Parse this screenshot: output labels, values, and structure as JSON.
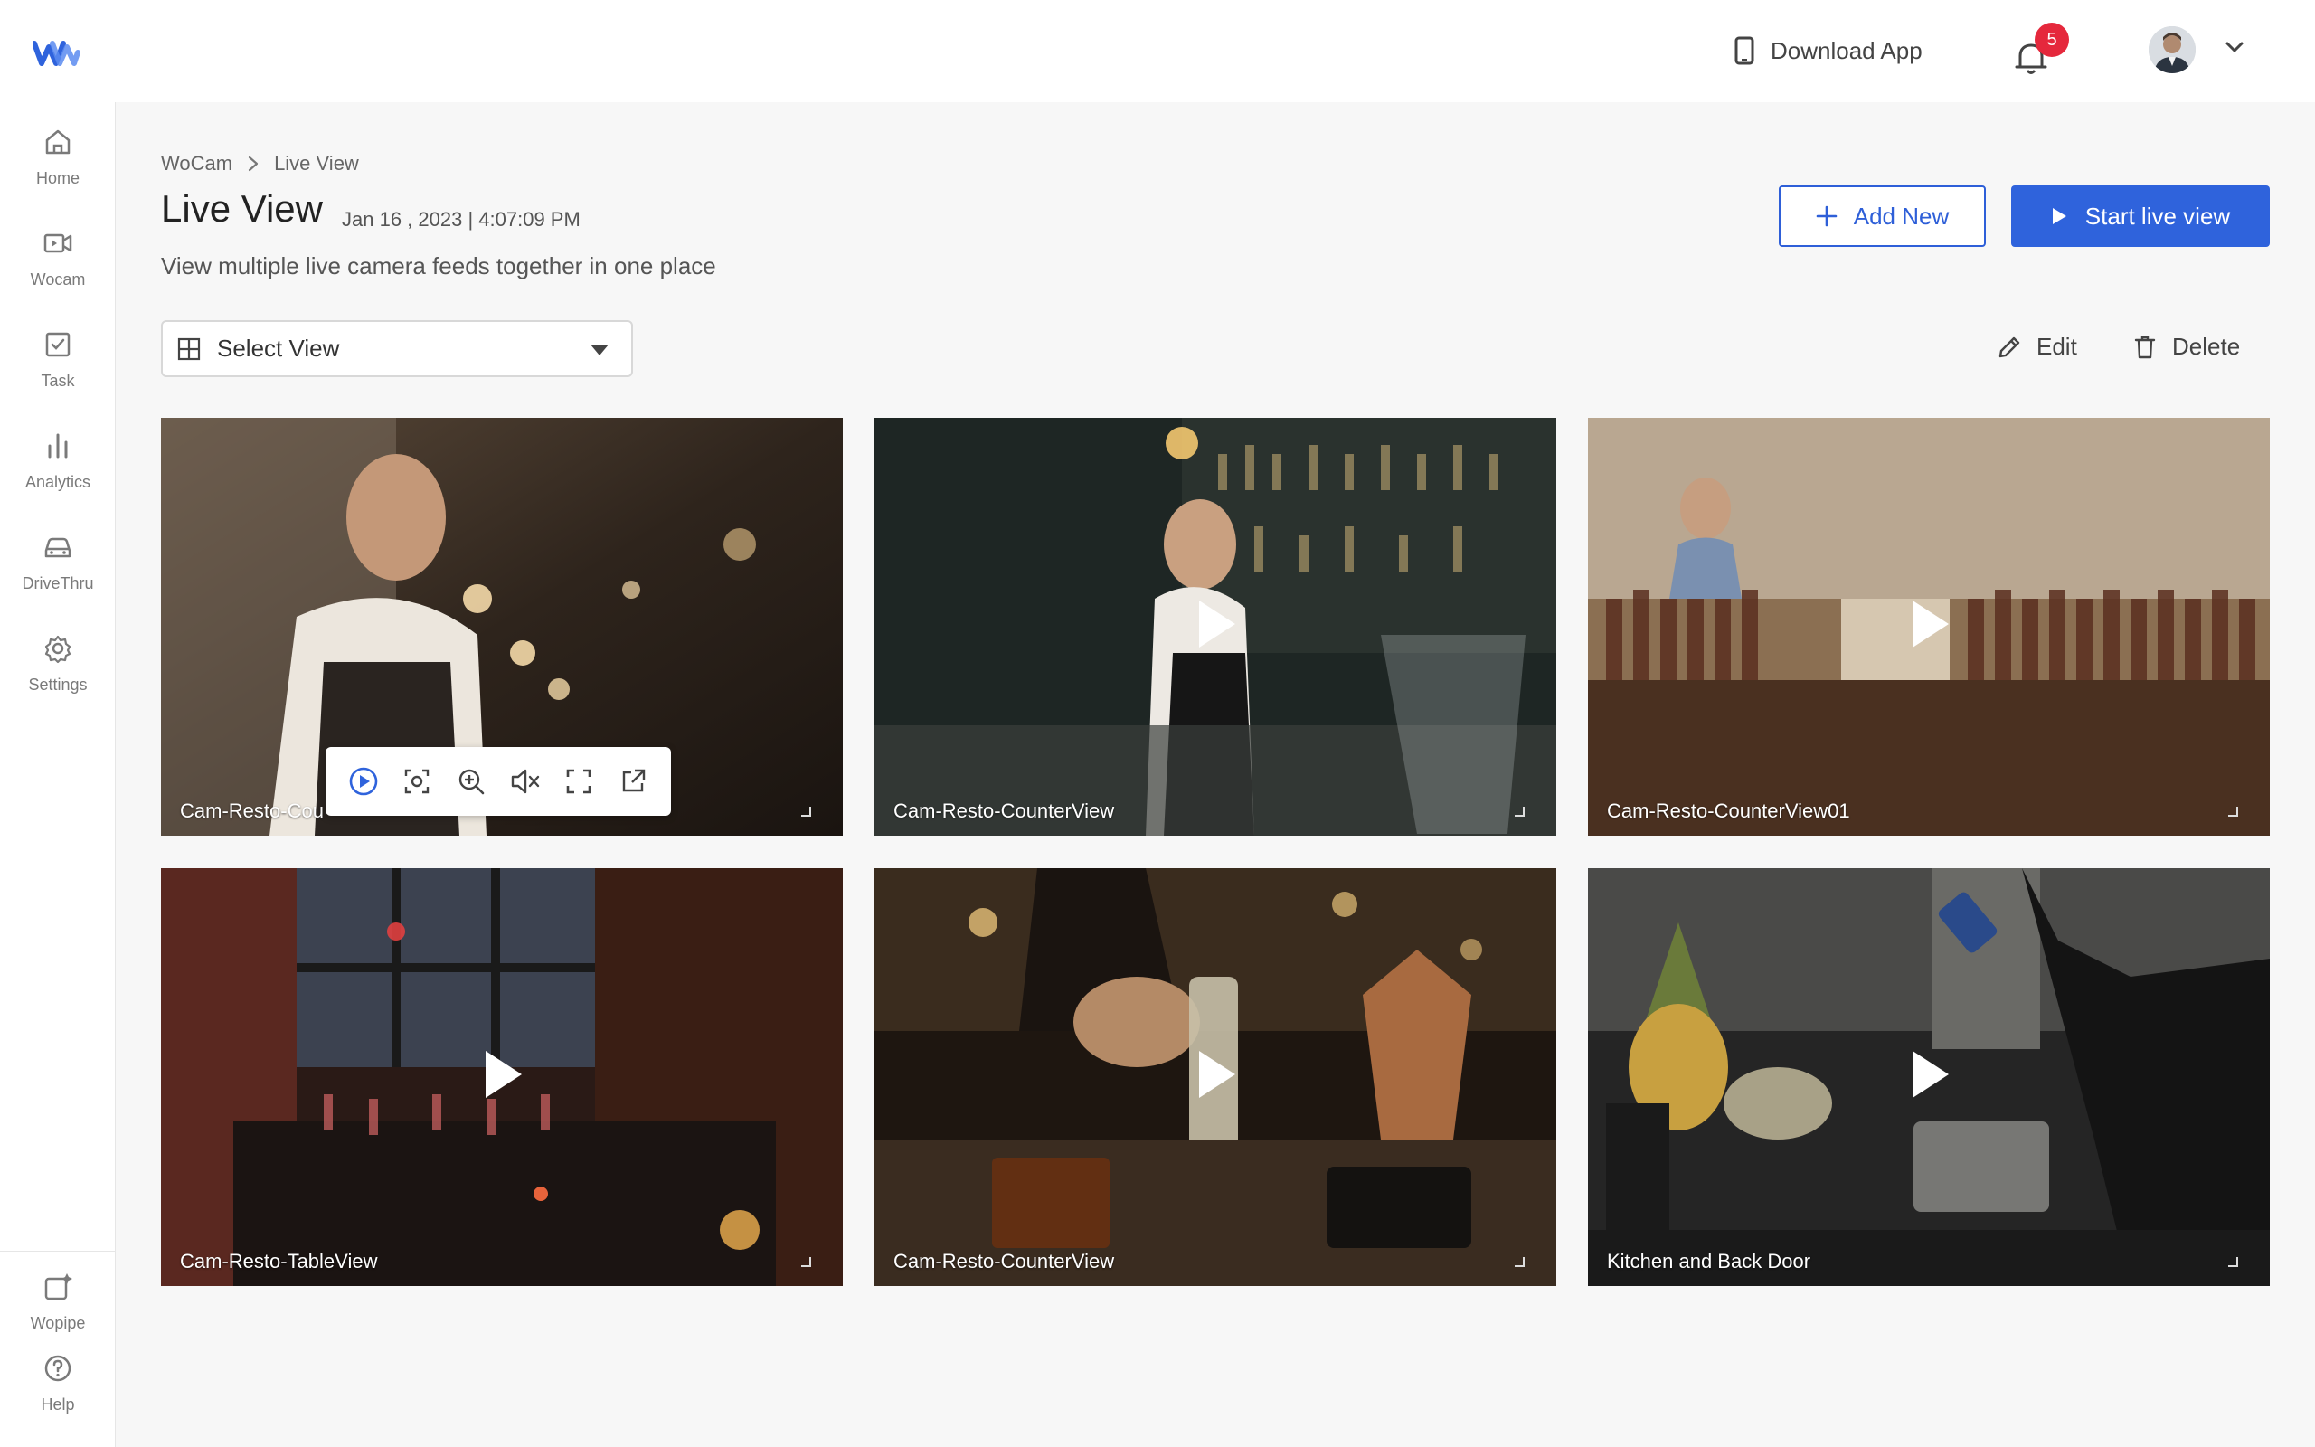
{
  "header": {
    "download_app": "Download App",
    "notifications_count": "5"
  },
  "sidebar": {
    "items": [
      {
        "label": "Home",
        "icon": "home-icon"
      },
      {
        "label": "Wocam",
        "icon": "video-camera-icon"
      },
      {
        "label": "Task",
        "icon": "task-checkbox-icon"
      },
      {
        "label": "Analytics",
        "icon": "bar-chart-icon"
      },
      {
        "label": "DriveThru",
        "icon": "car-icon"
      },
      {
        "label": "Settings",
        "icon": "gear-icon"
      }
    ],
    "bottom_items": [
      {
        "label": "Wopipe",
        "icon": "wopipe-icon"
      },
      {
        "label": "Help",
        "icon": "help-icon"
      }
    ]
  },
  "breadcrumb": {
    "root": "WoCam",
    "current": "Live View"
  },
  "page": {
    "title": "Live View",
    "timestamp": "Jan 16 , 2023 | 4:07:09 PM",
    "subtitle": "View multiple live camera feeds together in one place"
  },
  "actions": {
    "add_new": "Add New",
    "start_live_view": "Start live view",
    "edit": "Edit",
    "delete": "Delete"
  },
  "select_view": {
    "value": "Select View"
  },
  "cameras": [
    {
      "name": "Cam-Resto-Cou"
    },
    {
      "name": "Cam-Resto-CounterView"
    },
    {
      "name": "Cam-Resto-CounterView01"
    },
    {
      "name": "Cam-Resto-TableView"
    },
    {
      "name": "Cam-Resto-CounterView"
    },
    {
      "name": "Kitchen and Back Door"
    }
  ],
  "colors": {
    "accent": "#2f63dc",
    "badge": "#e5283c",
    "background": "#f7f7f7"
  }
}
